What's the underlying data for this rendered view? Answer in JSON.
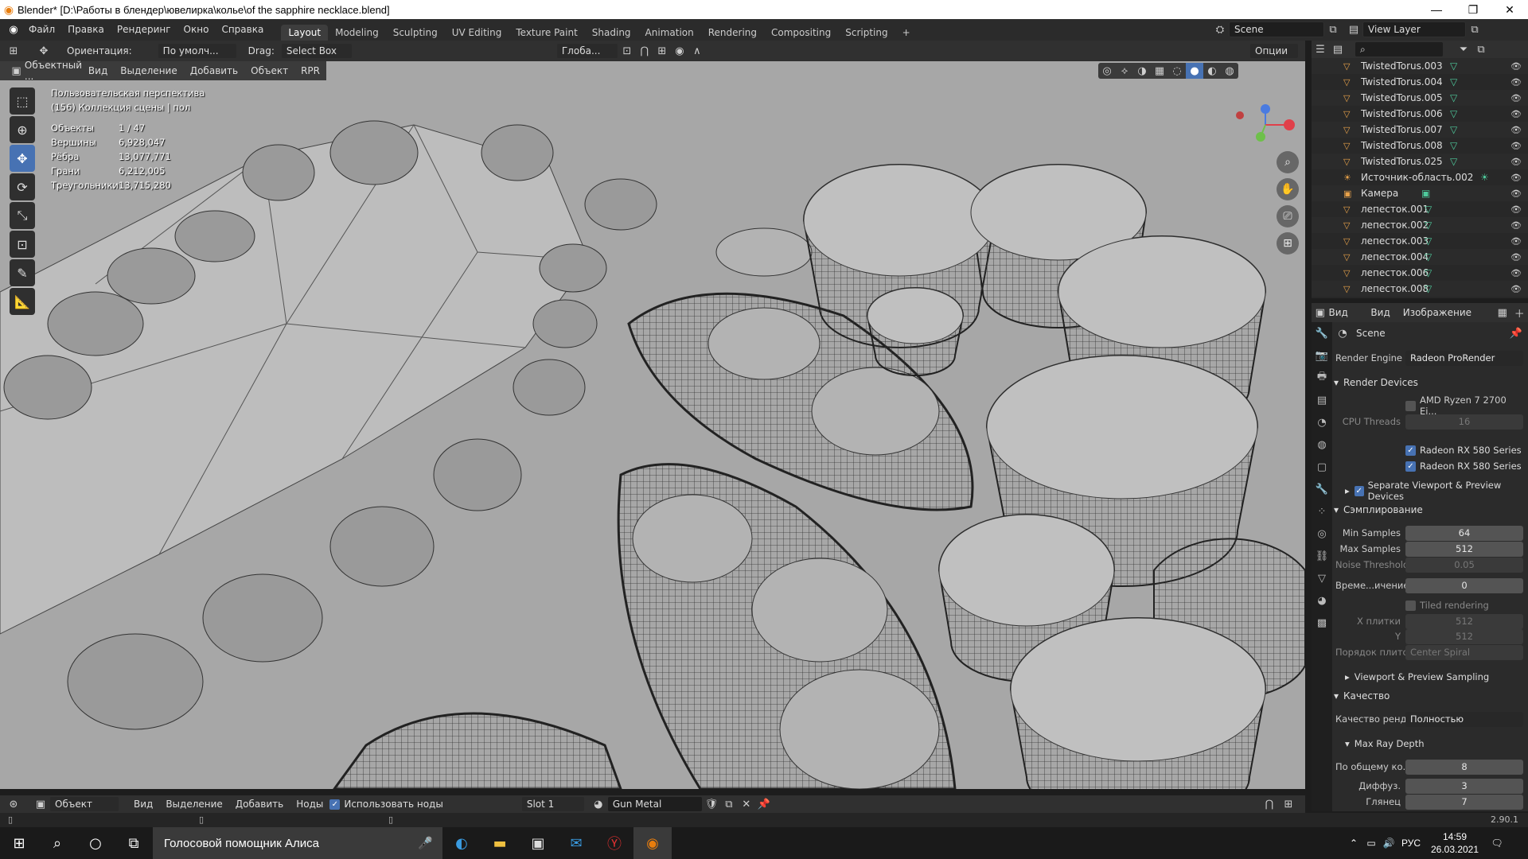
{
  "window": {
    "title": "Blender* [D:\\Работы в блендер\\ювелирка\\колье\\of the sapphire necklace.blend]",
    "min": "—",
    "max": "❐",
    "close": "✕"
  },
  "menu": [
    "Файл",
    "Правка",
    "Рендеринг",
    "Окно",
    "Справка"
  ],
  "workspaces": [
    "Layout",
    "Modeling",
    "Sculpting",
    "UV Editing",
    "Texture Paint",
    "Shading",
    "Animation",
    "Rendering",
    "Compositing",
    "Scripting"
  ],
  "add_ws": "+",
  "scene": {
    "name": "Scene",
    "view_layer": "View Layer"
  },
  "vp_header": {
    "orientation_label": "Ориентация:",
    "orientation_value": "По умолч...",
    "drag_label": "Drag:",
    "drag_value": "Select Box",
    "pivot": "Глоба...",
    "options": "Опции"
  },
  "vp_header2": {
    "mode": "Объектный ...",
    "items": [
      "Вид",
      "Выделение",
      "Добавить",
      "Объект",
      "RPR"
    ]
  },
  "stats": {
    "view": "Пользовательская перспектива",
    "collection": "(156) Коллекция сцены | пол",
    "rows": [
      {
        "label": "Объекты",
        "value": "1 / 47"
      },
      {
        "label": "Вершины",
        "value": "6,928,047"
      },
      {
        "label": "Рёбра",
        "value": "13,077,771"
      },
      {
        "label": "Грани",
        "value": "6,212,005"
      },
      {
        "label": "Треугольники",
        "value": "13,715,280"
      }
    ]
  },
  "outliner": {
    "search_placeholder": "",
    "rows": [
      "TwistedTorus.003",
      "TwistedTorus.004",
      "TwistedTorus.005",
      "TwistedTorus.006",
      "TwistedTorus.007",
      "TwistedTorus.008",
      "TwistedTorus.025",
      "Источник-область.002",
      "Камера",
      "лепесток.001",
      "лепесток.002",
      "лепесток.003",
      "лепесток.004",
      "лепесток.006",
      "лепесток.008"
    ]
  },
  "img_header": {
    "mode": "Вид",
    "items": [
      "Вид",
      "Изображение"
    ]
  },
  "props": {
    "context": "Scene",
    "render_engine_label": "Render Engine",
    "render_engine": "Radeon ProRender",
    "render_devices": "Render Devices",
    "cpu": "AMD Ryzen 7 2700 Ei...",
    "cpu_threads_label": "CPU Threads",
    "cpu_threads": "16",
    "gpu1": "Radeon RX 580 Series",
    "gpu2": "Radeon RX 580 Series",
    "separate": "Separate Viewport & Preview Devices",
    "sampling": "Сэмплирование",
    "min_samples_label": "Min Samples",
    "min_samples": "64",
    "max_samples_label": "Max Samples",
    "max_samples": "512",
    "noise_label": "Noise Threshold",
    "noise": "0.05",
    "time_label": "Време...ичением",
    "time": "0",
    "tiled": "Tiled rendering",
    "xtile_label": "X плитки",
    "xtile": "512",
    "ytile_label": "Y",
    "ytile": "512",
    "order_label": "Порядок плито",
    "order": "Center Spiral",
    "vp_sampling": "Viewport & Preview Sampling",
    "quality": "Качество",
    "render_quality_label": "Качество ренд...",
    "render_quality": "Полностью",
    "max_ray": "Max Ray Depth",
    "total_label": "По общему ко...",
    "total": "8",
    "diffuse_label": "Диффуз.",
    "diffuse": "3",
    "gloss_label": "Глянец",
    "gloss": "7"
  },
  "bottombar": {
    "mode": "Объект",
    "items": [
      "Вид",
      "Выделение",
      "Добавить",
      "Ноды"
    ],
    "use_nodes": "Использовать ноды",
    "slot": "Slot 1",
    "material": "Gun Metal"
  },
  "status": {
    "version": "2.90.1"
  },
  "taskbar": {
    "search": "Голосовой помощник Алиса",
    "lang": "РУС",
    "time": "14:59",
    "date": "26.03.2021"
  }
}
